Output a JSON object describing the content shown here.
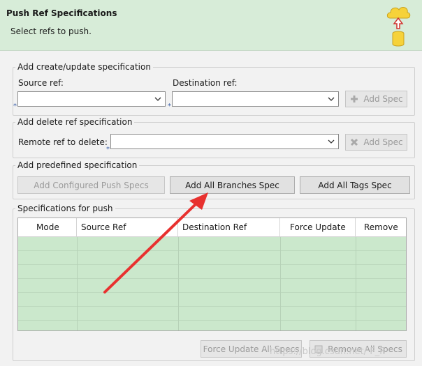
{
  "header": {
    "title": "Push Ref Specifications",
    "subtitle": "Select refs to push."
  },
  "create_group": {
    "legend": "Add create/update specification",
    "source_label": "Source ref:",
    "destination_label": "Destination ref:",
    "source_value": "",
    "destination_value": "",
    "add_button": "Add Spec"
  },
  "delete_group": {
    "legend": "Add delete ref specification",
    "remote_label": "Remote ref to delete:",
    "remote_value": "",
    "add_button": "Add Spec"
  },
  "predefined_group": {
    "legend": "Add predefined specification",
    "configured_button": "Add Configured Push Specs",
    "branches_button": "Add All Branches Spec",
    "tags_button": "Add All Tags Spec"
  },
  "specs_group": {
    "legend": "Specifications for push",
    "columns": [
      "Mode",
      "Source Ref",
      "Destination Ref",
      "Force Update",
      "Remove"
    ],
    "row_count": 7,
    "force_button": "Force Update All Specs",
    "remove_button": "Remove All Specs"
  },
  "watermark": "https://blog.csdn.net/ F_F",
  "colors": {
    "header_bg": "#d7ecd8",
    "row_green": "#cbe8cc",
    "arrow_red": "#e8312f",
    "logo_yellow": "#f6d23a"
  }
}
